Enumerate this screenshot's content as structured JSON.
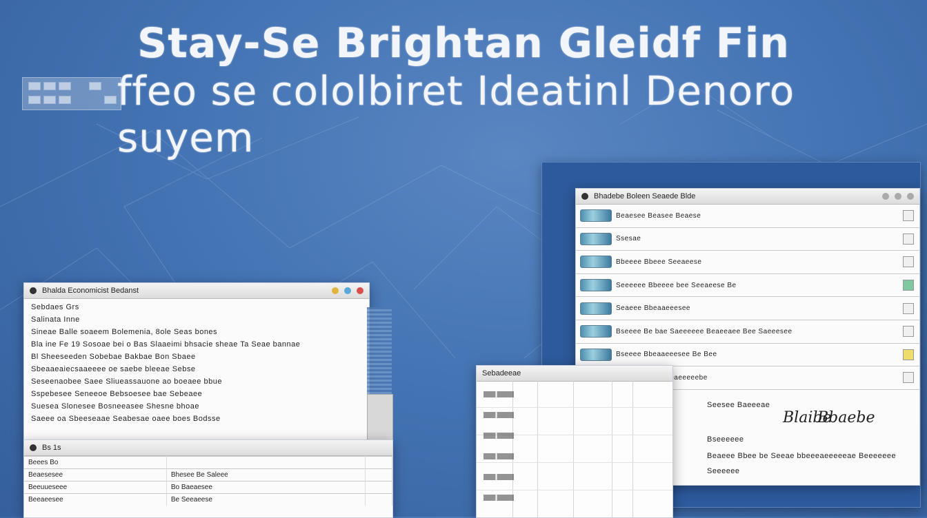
{
  "heading": {
    "line1": "Stay-Se Brightan Gleidf Fin",
    "line2": "ffeo se cololbiret Ideatinl Denoro suyem"
  },
  "left_window": {
    "title": "Bhalda Economicist Bedanst",
    "subtitle": "Sebdaes Grs",
    "doc_lines": [
      "Salinata Inne",
      "Sineae Balle soaeem Bolemenia, 8ole Seas bones",
      "Bla ine Fe 19 Sosoae bei o Bas Slaaeimi bhsacie sheae Ta Seae bannae",
      "Bl Sheeseeden Sobebae Bakbae Bon Sbaee",
      "Sbeaaeaiecsaaeeee oe saebe bleeae Sebse",
      "Seseenaobee Saee Sliueassauone ao boeaee bbue",
      "Sspebesee Seneeoe Bebsoesee bae Sebeaee",
      "Suesea Slonesee Bosneeasee Shesne bhoae",
      "Saeee oa Sbeeseaae Seabesae oaee boes Bodsse"
    ],
    "bottom_title": "Bs 1s",
    "bottom_rows": [
      [
        "Beees Bo",
        "",
        ""
      ],
      [
        "Beaesesee",
        "Bhesee Be Saleee",
        ""
      ],
      [
        "Beeuueseee",
        "Bo Baeaesee",
        ""
      ],
      [
        "Beeaeesee",
        "Be Seeaeese",
        ""
      ]
    ]
  },
  "right_window": {
    "title": "Bhadebe Boleen Seaede Blde",
    "rows": [
      "Beaesee Beasee Beaese",
      "Ssesae",
      "Bbeeee Bbeee Seeaeese",
      "Seeeeee Bbeeee bee Seeaeese Be",
      "Seaeee Bbeaaeeesee",
      "Bseeee Be bae Saeeeeee Beaeeaee Bee Saeeesee",
      "Bseeee Bbeaaeeesee Be Bee",
      "Beeeeeeee Seaeaeeeeebe"
    ],
    "footer_lines": [
      "Seesee Baeeeae",
      "Bseeeeee",
      "Beaeee Bbee be Seeae bbeeeaeeeeeae Beeeeeee",
      "Seeeeee"
    ],
    "signatures": [
      "Blaibe",
      "Bbaebe"
    ]
  },
  "middle_window": {
    "title": "Sebadeeae"
  }
}
